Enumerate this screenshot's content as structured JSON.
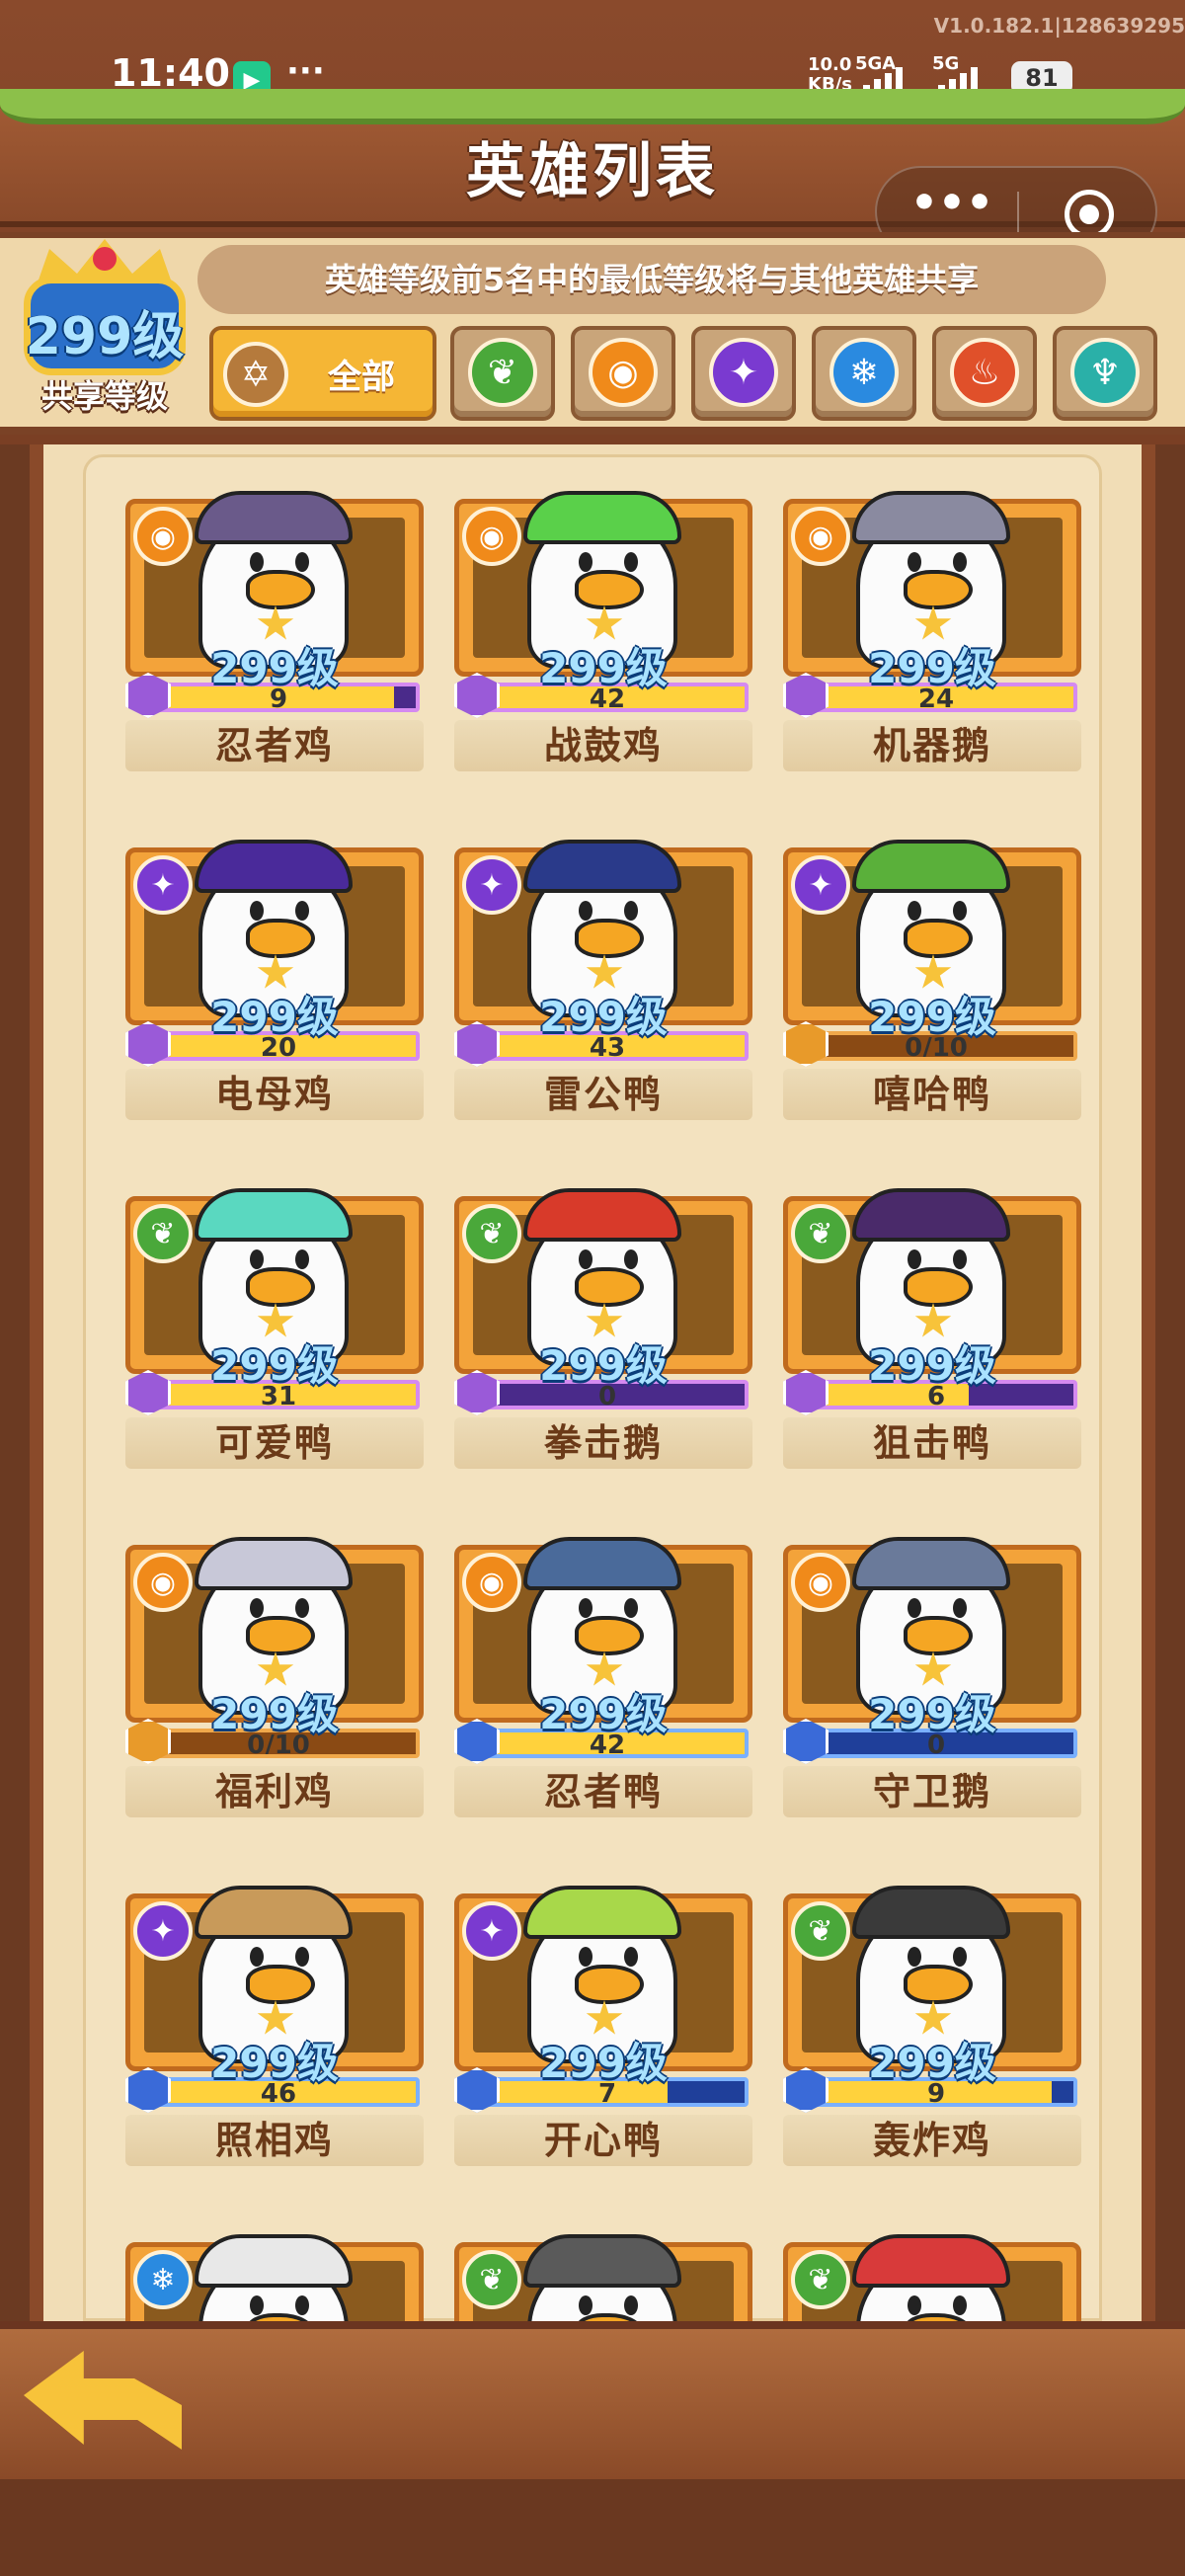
{
  "status": {
    "time": "11:40",
    "app_icon": "▶",
    "dots": "···",
    "version": "V1.0.182.1|128639295",
    "net_speed": "10.0",
    "net_unit": "KB/s",
    "sim1": "5GA",
    "sim2": "5G",
    "battery": "81"
  },
  "header": {
    "title": "英雄列表",
    "capsule_menu": "•••"
  },
  "shared_level": {
    "level": "299级",
    "caption": "共享等级"
  },
  "notice": "英雄等级前5名中的最低等级将与其他英雄共享",
  "tabs": {
    "all_label": "全部",
    "all_icon": "✡",
    "elements": [
      {
        "icon": "nature-icon",
        "glyph": "❦",
        "color": "#4aa83a"
      },
      {
        "icon": "sun-icon",
        "glyph": "◉",
        "color": "#f08a1a"
      },
      {
        "icon": "shadow-icon",
        "glyph": "✦",
        "color": "#7a3ad0"
      },
      {
        "icon": "frost-icon",
        "glyph": "❄",
        "color": "#2a8ae0"
      },
      {
        "icon": "fire-icon",
        "glyph": "♨",
        "color": "#e0502a"
      },
      {
        "icon": "water-icon",
        "glyph": "♆",
        "color": "#2ab0a8"
      }
    ]
  },
  "heroes": [
    {
      "name": "忍者鸡",
      "level": "299级",
      "shards": "9",
      "fill": 0.92,
      "bar": "purple",
      "elem": "sun",
      "hat": "#6a5a8a"
    },
    {
      "name": "战鼓鸡",
      "level": "299级",
      "shards": "42",
      "fill": 1.0,
      "bar": "purple",
      "elem": "sun",
      "hat": "#5ad04a"
    },
    {
      "name": "机器鹅",
      "level": "299级",
      "shards": "24",
      "fill": 1.0,
      "bar": "purple",
      "elem": "sun",
      "hat": "#8a8aa0"
    },
    {
      "name": "电母鸡",
      "level": "299级",
      "shards": "20",
      "fill": 1.0,
      "bar": "purple",
      "elem": "shadow",
      "hat": "#4a2a9a"
    },
    {
      "name": "雷公鸭",
      "level": "299级",
      "shards": "43",
      "fill": 1.0,
      "bar": "purple",
      "elem": "shadow",
      "hat": "#2a3a8a"
    },
    {
      "name": "嘻哈鸭",
      "level": "299级",
      "shards": "0/10",
      "fill": 0.0,
      "bar": "orange",
      "elem": "shadow",
      "hat": "#5ab03a"
    },
    {
      "name": "可爱鸭",
      "level": "299级",
      "shards": "31",
      "fill": 1.0,
      "bar": "purple",
      "elem": "nature",
      "hat": "#5ad8c0"
    },
    {
      "name": "拳击鹅",
      "level": "299级",
      "shards": "0",
      "fill": 0.0,
      "bar": "purple",
      "elem": "nature",
      "hat": "#d83a2a"
    },
    {
      "name": "狙击鸭",
      "level": "299级",
      "shards": "6",
      "fill": 0.62,
      "bar": "purple",
      "elem": "nature",
      "hat": "#4a2a6a"
    },
    {
      "name": "福利鸡",
      "level": "299级",
      "shards": "0/10",
      "fill": 0.0,
      "bar": "orange",
      "elem": "sun",
      "hat": "#c8c8d8"
    },
    {
      "name": "忍者鸭",
      "level": "299级",
      "shards": "42",
      "fill": 1.0,
      "bar": "blue",
      "elem": "sun",
      "hat": "#4a6a9a"
    },
    {
      "name": "守卫鹅",
      "level": "299级",
      "shards": "0",
      "fill": 0.0,
      "bar": "blue",
      "elem": "sun",
      "hat": "#6a7a9a"
    },
    {
      "name": "照相鸡",
      "level": "299级",
      "shards": "46",
      "fill": 1.0,
      "bar": "blue",
      "elem": "shadow",
      "hat": "#c89a5a"
    },
    {
      "name": "开心鸭",
      "level": "299级",
      "shards": "7",
      "fill": 0.72,
      "bar": "blue",
      "elem": "shadow",
      "hat": "#a8d84a"
    },
    {
      "name": "轰炸鸡",
      "level": "299级",
      "shards": "9",
      "fill": 0.92,
      "bar": "blue",
      "elem": "nature",
      "hat": "#3a3a3a"
    },
    {
      "name": "",
      "level": "",
      "shards": "",
      "fill": 0.0,
      "bar": "blue",
      "elem": "frost",
      "hat": "#e8e8e8"
    },
    {
      "name": "",
      "level": "",
      "shards": "",
      "fill": 0.0,
      "bar": "blue",
      "elem": "nature",
      "hat": "#5a5a5a"
    },
    {
      "name": "",
      "level": "",
      "shards": "",
      "fill": 0.0,
      "bar": "blue",
      "elem": "nature",
      "hat": "#d83a3a"
    }
  ],
  "element_colors": {
    "sun": "#f08a1a",
    "shadow": "#7a3ad0",
    "nature": "#4aa83a",
    "frost": "#2a8ae0"
  },
  "element_glyphs": {
    "sun": "◉",
    "shadow": "✦",
    "nature": "❦",
    "frost": "❄"
  },
  "shard_colors": {
    "purple": "#9a5ad8",
    "blue": "#3a6ad8",
    "orange": "#e89a2a"
  },
  "back_icon": "back-arrow-icon"
}
